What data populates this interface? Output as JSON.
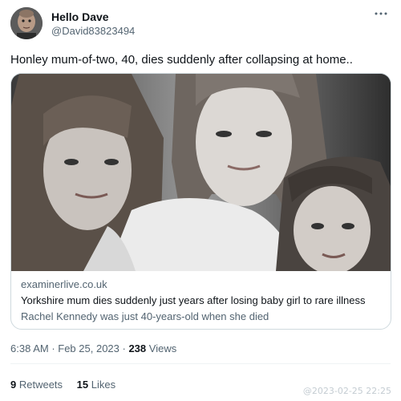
{
  "user": {
    "display_name": "Hello Dave",
    "handle": "@David83823494",
    "avatar_icon": "user-avatar-photo"
  },
  "more_icon": "more-horizontal-icon",
  "tweet": {
    "text": "Honley mum-of-two, 40, dies suddenly after collapsing at home.."
  },
  "card": {
    "image_icon": "article-photo",
    "domain": "examinerlive.co.uk",
    "title": "Yorkshire mum dies suddenly just years after losing baby girl to rare illness",
    "description": "Rachel Kennedy was just 40-years-old when she died"
  },
  "meta": {
    "time": "6:38 AM",
    "separator1": " · ",
    "date": "Feb 25, 2023",
    "separator2": " · ",
    "views_count": "238",
    "views_label": " Views"
  },
  "stats": {
    "retweets_count": "9",
    "retweets_label": " Retweets",
    "likes_count": "15",
    "likes_label": " Likes"
  },
  "watermark": "@2023-02-25 22:25",
  "colors": {
    "text_primary": "#0f1419",
    "text_secondary": "#536471",
    "border": "#cfd9de"
  }
}
